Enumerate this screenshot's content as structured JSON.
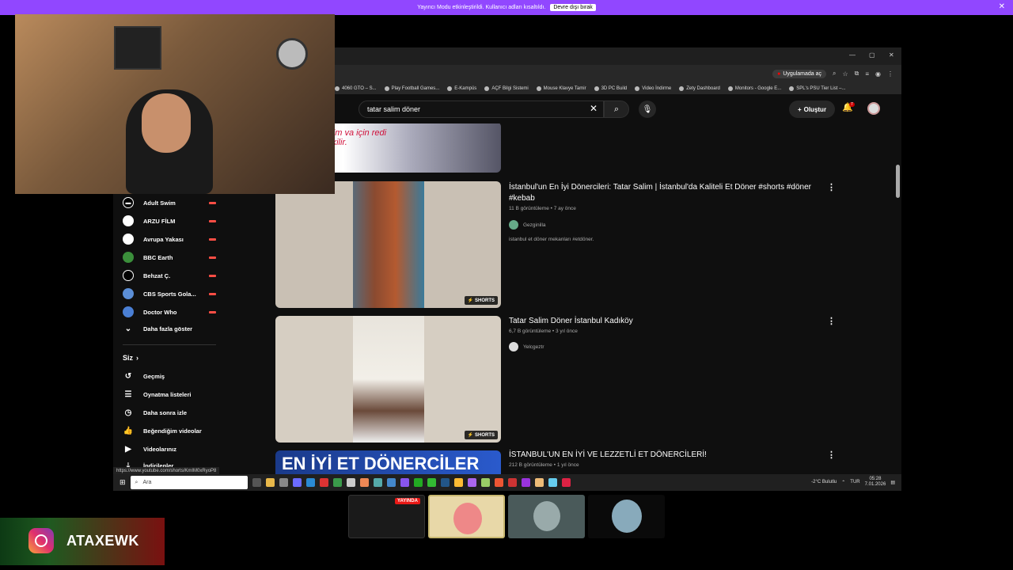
{
  "streamer_bar": {
    "message": "Yayıncı Modu etkinleştirildi. Kullanıcı adları kısaltıldı.",
    "disable_label": "Devre dışı bırak",
    "close": "✕"
  },
  "window": {
    "minimize": "—",
    "maximize": "▢",
    "close": "✕"
  },
  "toolbar": {
    "app_open_label": "Uygulamada aç"
  },
  "bookmarks": [
    "4060 GTO – S...",
    "Play Football Games...",
    "E-Kampüs",
    "AÇF Bilgi Sistemi",
    "Mouse Klavye Tamir",
    "3D PC Build",
    "Video İndirme",
    "Zety Dashboard",
    "Monitors - Google E...",
    "SPL's PSU Tier List –..."
  ],
  "header": {
    "search_value": "tatar salim döner",
    "create_label": "Oluştur",
    "notif_count": "7"
  },
  "sidebar": {
    "subscriptions": [
      "Adult Swim",
      "ARZU FİLM",
      "Avrupa Yakası",
      "BBC Earth",
      "Behzat Ç.",
      "CBS Sports Gola...",
      "Doctor Who"
    ],
    "show_more": "Daha fazla göster",
    "you_header": "Siz",
    "you_items": [
      "Geçmiş",
      "Oynatma listeleri",
      "Daha sonra izle",
      "Beğendiğim videolar",
      "Videolarınız",
      "İndirilenler"
    ]
  },
  "videos": [
    {
      "title": "İstanbul'un En İyi Dönercileri: Tatar Salim | İstanbul'da Kaliteli Et Döner #shorts #döner #kebab",
      "meta": "11 B görüntüleme • 7 ay önce",
      "channel": "Gezginilla",
      "desc": "istanbul et döner mekanları #etdöner.",
      "badge": "SHORTS"
    },
    {
      "title": "Tatar Salim Döner İstanbul Kadıköy",
      "meta": "6,7 B görüntüleme • 3 yıl önce",
      "channel": "Yelcgeztr",
      "badge": "SHORTS"
    },
    {
      "title": "İSTANBUL'UN EN İYİ VE LEZZETLİ ET DÖNERCİLERİ!",
      "meta": "212 B görüntüleme • 1 yıl önce",
      "thumb_text": "EN İYİ ET DÖNERCİLER"
    }
  ],
  "partial_thumb_text": "Dilim va için redi çekilir.",
  "status_url": "https://www.youtube.com/shorts/KmIM0xRyoP8",
  "taskbar": {
    "search_placeholder": "Ara",
    "weather": "-2°C  Bulutlu",
    "lang": "TUR",
    "time": "05:28",
    "date": "7.01.2026"
  },
  "preview": {
    "live_label": "YAYINDA"
  },
  "instagram": {
    "handle": "ATAXEWK"
  }
}
